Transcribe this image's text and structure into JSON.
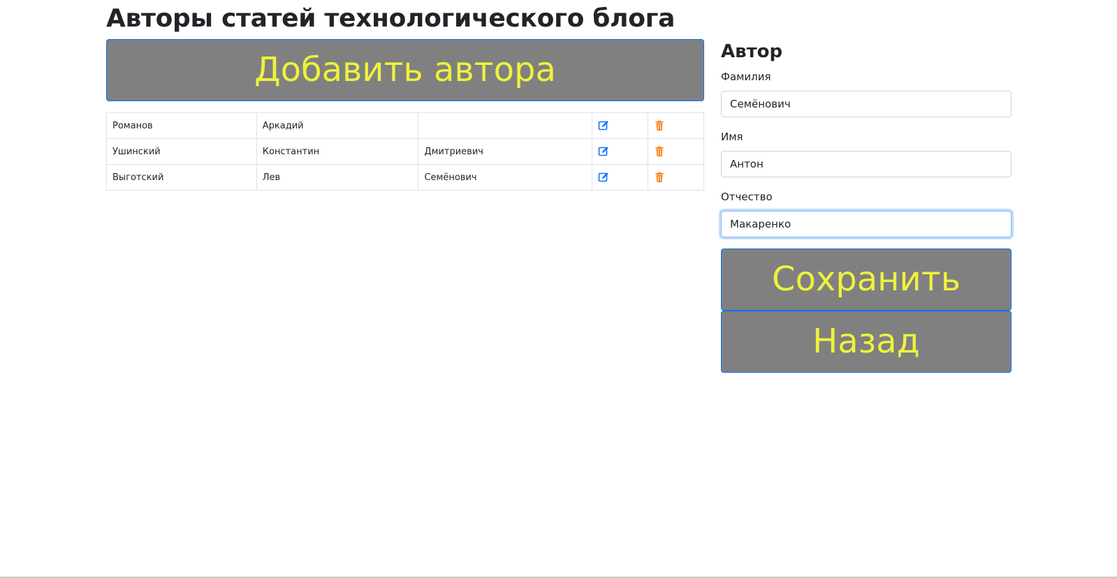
{
  "page": {
    "title": "Авторы статей технологического блога"
  },
  "actions": {
    "add_label": "Добавить автора"
  },
  "table": {
    "rows": [
      {
        "last_name": "Романов",
        "first_name": "Аркадий",
        "middle_name": ""
      },
      {
        "last_name": "Ушинский",
        "first_name": "Константин",
        "middle_name": "Дмитриевич"
      },
      {
        "last_name": "Выготский",
        "first_name": "Лев",
        "middle_name": "Семёнович"
      }
    ]
  },
  "form": {
    "title": "Автор",
    "last_name_label": "Фамилия",
    "last_name_value": "Семёнович",
    "first_name_label": "Имя",
    "first_name_value": "Антон",
    "middle_name_label": "Отчество",
    "middle_name_value": "Макаренко",
    "save_label": "Сохранить",
    "back_label": "Назад"
  },
  "colors": {
    "button_bg": "#808080",
    "button_text": "#eef23c",
    "button_border": "#0d6efd",
    "edit_icon": "#0d6efd",
    "delete_icon": "#fd7e14"
  },
  "icons": {
    "edit": "pencil-square-icon",
    "delete": "trash-icon"
  }
}
